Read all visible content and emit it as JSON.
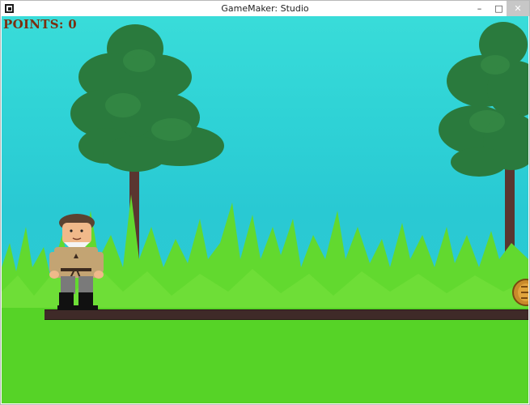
{
  "window": {
    "title": "GameMaker: Studio",
    "controls": {
      "minimize": "–",
      "maximize": "□",
      "close": "✕"
    }
  },
  "hud": {
    "points_label": "POINTS: 0"
  },
  "colors": {
    "sky": "#2fd3d6",
    "ground": "#56d327",
    "grass": "#62d92f",
    "tree_foliage": "#2a7a3d",
    "tree_trunk": "#5a3630",
    "platform": "#3f2a28",
    "score_text": "#7b2f10"
  },
  "icons": {
    "app": "gamemaker-icon",
    "player": "player-character-sprite",
    "coin": "coin-sprite"
  }
}
